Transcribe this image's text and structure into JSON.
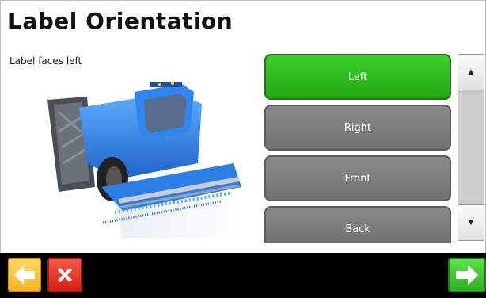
{
  "page": {
    "title": "Label Orientation",
    "subtitle": "Label faces left"
  },
  "illustration": {
    "icon": "combine-harvester-illustration",
    "accent": "#2f7fe0"
  },
  "options": [
    {
      "label": "Left",
      "selected": true
    },
    {
      "label": "Right",
      "selected": false
    },
    {
      "label": "Front",
      "selected": false
    },
    {
      "label": "Back",
      "selected": false
    }
  ],
  "scrollbar": {
    "up_glyph": "▲",
    "down_glyph": "▼"
  },
  "nav": {
    "back_icon": "back-arrow-icon",
    "cancel_icon": "close-icon",
    "next_icon": "forward-arrow-icon"
  },
  "colors": {
    "selected": "#2bb31c",
    "unselected": "#7f7f7f",
    "back": "#f6b21b",
    "cancel": "#e02a1c",
    "next": "#35c423"
  }
}
